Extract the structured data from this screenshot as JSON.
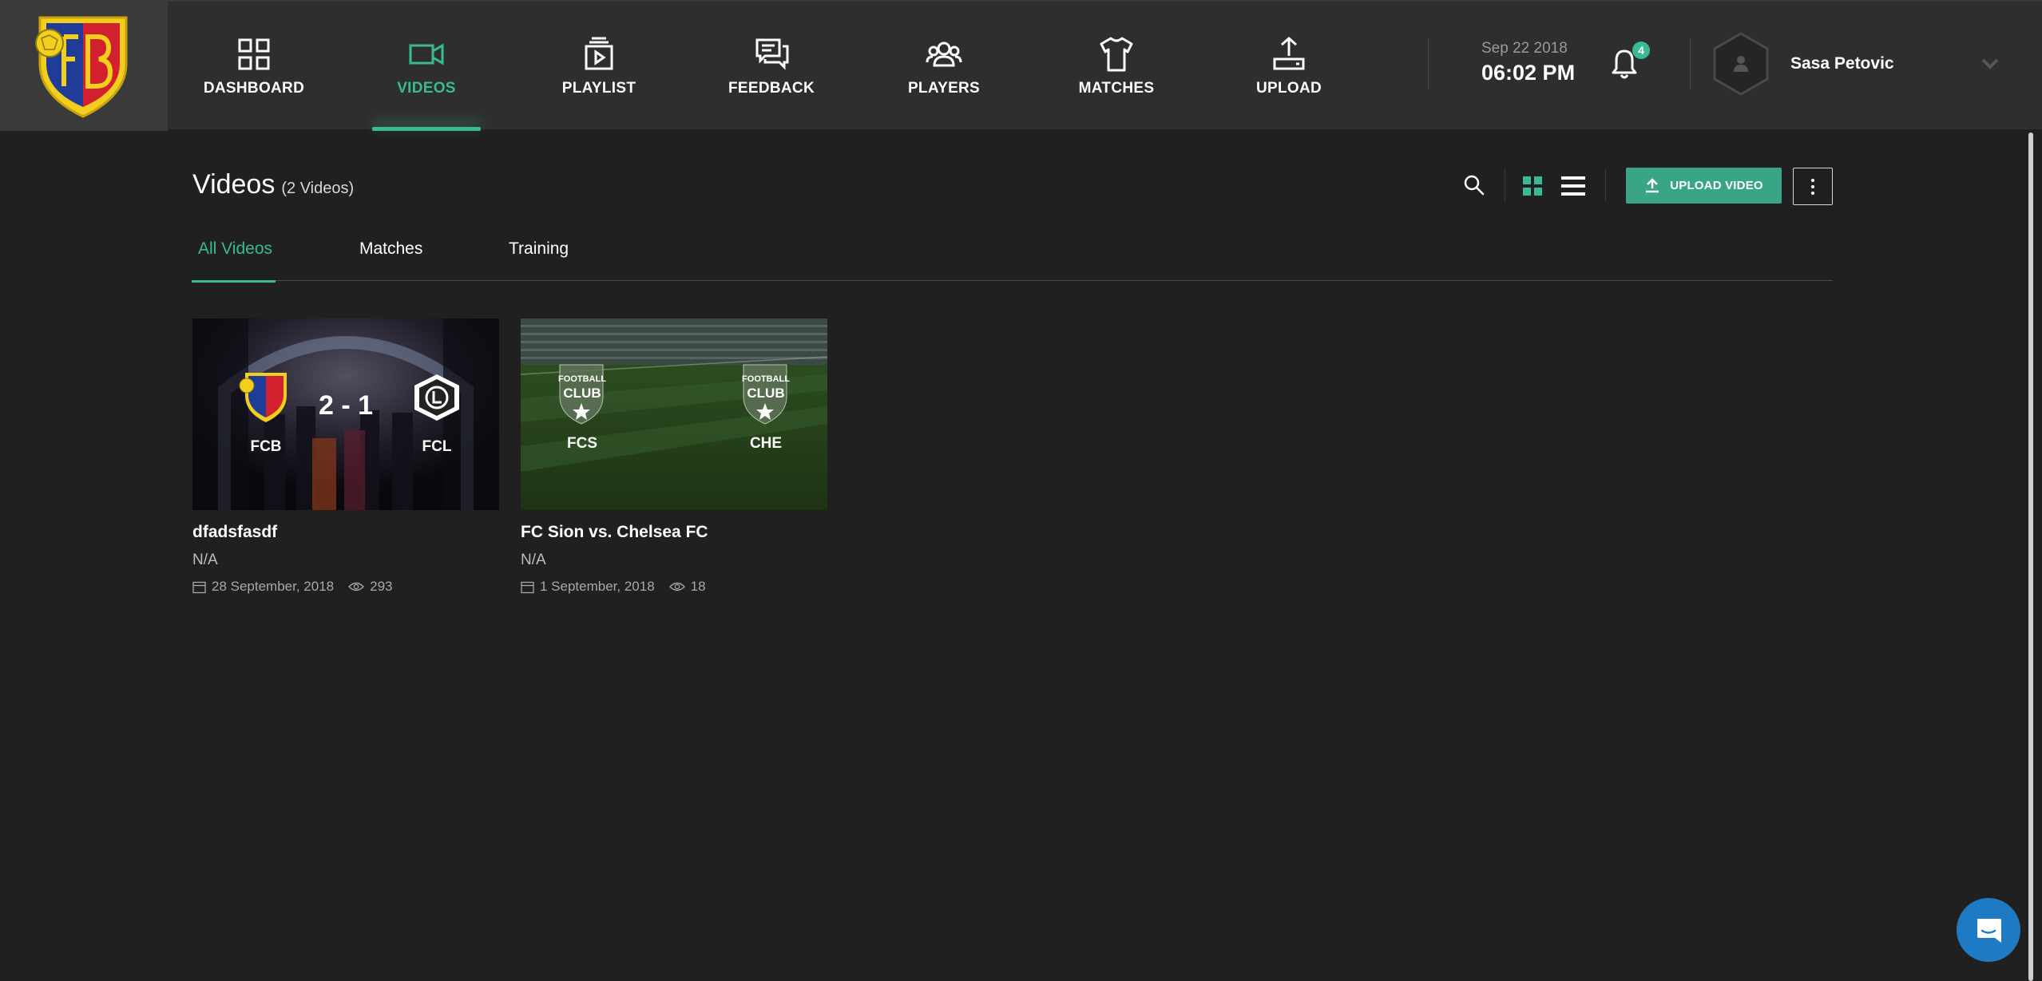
{
  "header": {
    "nav": [
      {
        "label": "DASHBOARD",
        "icon": "grid-icon"
      },
      {
        "label": "VIDEOS",
        "icon": "video-camera-icon",
        "active": true
      },
      {
        "label": "PLAYLIST",
        "icon": "playlist-icon"
      },
      {
        "label": "FEEDBACK",
        "icon": "feedback-chat-icon"
      },
      {
        "label": "PLAYERS",
        "icon": "players-group-icon"
      },
      {
        "label": "MATCHES",
        "icon": "jersey-icon"
      },
      {
        "label": "UPLOAD",
        "icon": "upload-tray-icon"
      }
    ],
    "date": "Sep 22 2018",
    "time": "06:02 PM",
    "notification_count": "4",
    "user_name": "Sasa Petovic"
  },
  "page": {
    "title": "Videos",
    "count": "(2 Videos)",
    "upload_button": "UPLOAD VIDEO",
    "tabs": [
      {
        "label": "All Videos",
        "active": true
      },
      {
        "label": "Matches"
      },
      {
        "label": "Training"
      }
    ]
  },
  "videos": [
    {
      "title": "dfadsfasdf",
      "subtitle": "N/A",
      "date": "28 September, 2018",
      "views": "293",
      "home": "FCB",
      "away": "FCL",
      "score": "2 - 1"
    },
    {
      "title": "FC Sion vs. Chelsea FC",
      "subtitle": "N/A",
      "date": "1 September, 2018",
      "views": "18",
      "home": "FCS",
      "away": "CHE",
      "badge_top": "FOOTBALL",
      "badge_mid": "CLUB"
    }
  ],
  "colors": {
    "accent": "#3aba94",
    "background": "#202020",
    "topbar": "#2e2e2e",
    "chat": "#1f7ac4"
  }
}
